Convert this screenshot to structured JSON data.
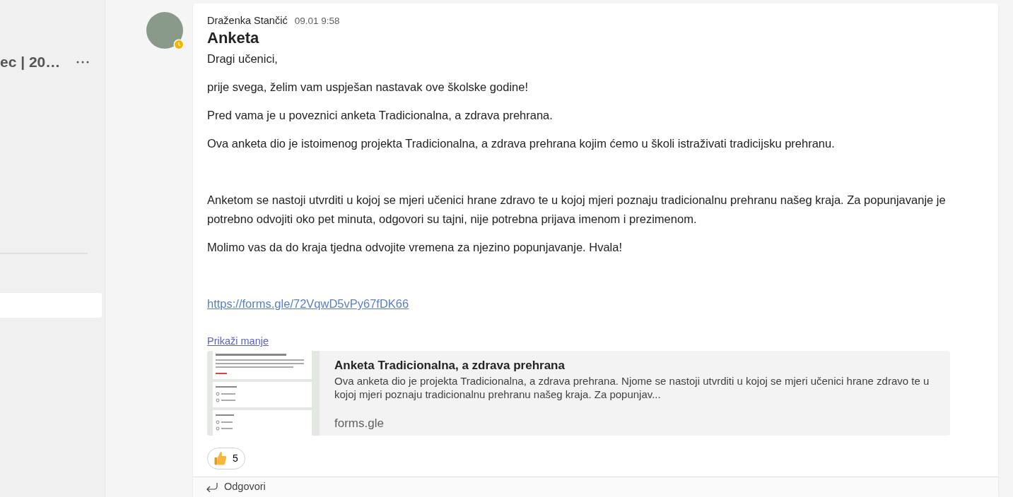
{
  "sidebar": {
    "title": "ec | 20…",
    "selected_item": true
  },
  "post": {
    "author": "Draženka Stančić",
    "time": "09.01 9:58",
    "away": true,
    "subject": "Anketa",
    "paragraphs": [
      {
        "kind": "text",
        "text": "Dragi učenici,",
        "space_before": false
      },
      {
        "kind": "text",
        "text": "prije svega, želim vam uspješan nastavak ove školske godine!",
        "space_before": false
      },
      {
        "kind": "text",
        "text": "Pred vama je u poveznici anketa Tradicionalna, a zdrava prehrana.",
        "space_before": false
      },
      {
        "kind": "text",
        "text": "Ova anketa dio je istoimenog projekta Tradicionalna, a zdrava prehrana kojim ćemo u školi istraživati tradicijsku prehranu.",
        "space_before": false
      },
      {
        "kind": "text",
        "text": "Anketom se nastoji utvrditi u kojoj se mjeri učenici hrane zdravo te u kojoj mjeri poznaju tradicionalnu prehranu našeg kraja. Za popunjavanje je potrebno odvojiti oko pet minuta, odgovori su tajni, nije potrebna prijava imenom i prezimenom.",
        "space_before": true
      },
      {
        "kind": "text",
        "text": "Molimo vas da do kraja tjedna odvojite vremena za njezino popunjavanje. Hvala!",
        "space_before": false
      },
      {
        "kind": "link",
        "text": "https://forms.gle/72VqwD5vPy67fDK66",
        "space_before": true
      }
    ],
    "show_less": "Prikaži manje",
    "preview": {
      "title": "Anketa Tradicionalna, a zdrava prehrana",
      "description": "Ova anketa dio je projekta Tradicionalna, a zdrava prehrana. Njome se nastoji utvrditi u kojoj se mjeri učenici hrane zdravo te u kojoj mjeri poznaju tradicionalnu prehranu našeg kraja. Za popunjav...",
      "domain": "forms.gle"
    },
    "reactions": [
      {
        "count": "5"
      }
    ],
    "reply": "Odgovori"
  }
}
